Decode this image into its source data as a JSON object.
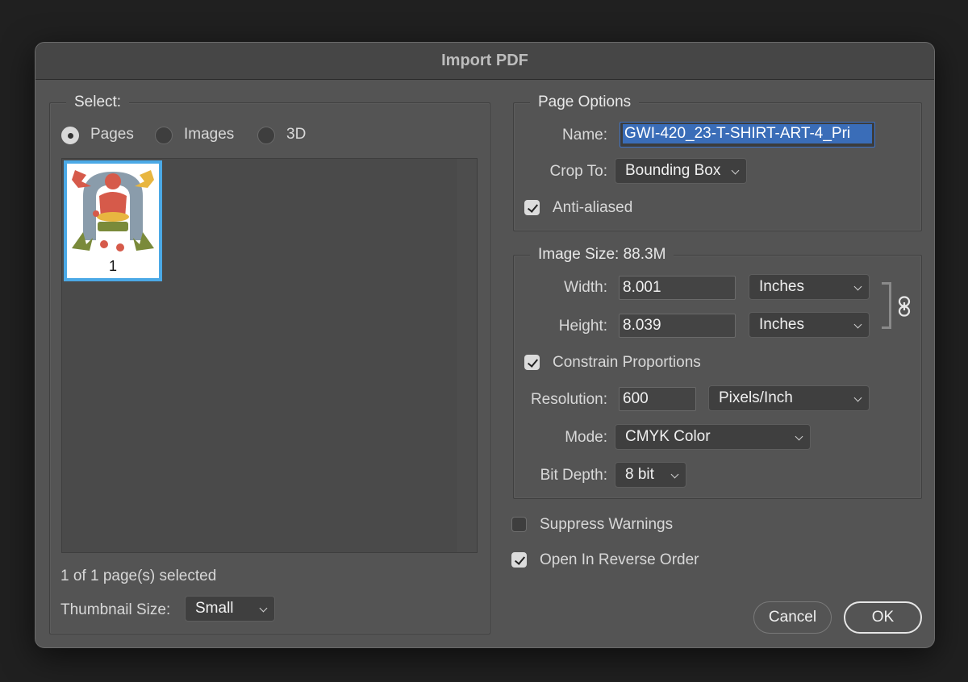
{
  "dialog": {
    "title": "Import PDF"
  },
  "select_group": {
    "label": "Select:",
    "radios": [
      {
        "label": "Pages",
        "checked": true
      },
      {
        "label": "Images",
        "checked": false
      },
      {
        "label": "3D",
        "checked": false
      }
    ],
    "thumbnails": [
      {
        "page_number": "1",
        "selected": true
      }
    ],
    "selection_status": "1 of 1 page(s) selected",
    "thumbnail_size": {
      "label": "Thumbnail Size:",
      "value": "Small"
    }
  },
  "page_options": {
    "label": "Page Options",
    "name": {
      "label": "Name:",
      "value": "GWI-420_23-T-SHIRT-ART-4_Pri"
    },
    "crop_to": {
      "label": "Crop To:",
      "value": "Bounding Box"
    },
    "anti_aliased": {
      "label": "Anti-aliased",
      "checked": true
    }
  },
  "image_size": {
    "label": "Image Size: 88.3M",
    "width": {
      "label": "Width:",
      "value": "8.001",
      "unit": "Inches"
    },
    "height": {
      "label": "Height:",
      "value": "8.039",
      "unit": "Inches"
    },
    "constrain": {
      "label": "Constrain Proportions",
      "checked": true
    },
    "resolution": {
      "label": "Resolution:",
      "value": "600",
      "unit": "Pixels/Inch"
    },
    "mode": {
      "label": "Mode:",
      "value": "CMYK Color"
    },
    "bit_depth": {
      "label": "Bit Depth:",
      "value": "8 bit"
    }
  },
  "options": {
    "suppress_warnings": {
      "label": "Suppress Warnings",
      "checked": false
    },
    "reverse_order": {
      "label": "Open In Reverse Order",
      "checked": true
    }
  },
  "buttons": {
    "cancel": "Cancel",
    "ok": "OK"
  },
  "colors": {
    "accent": "#4ba9e6",
    "selection": "#3a6db8"
  }
}
